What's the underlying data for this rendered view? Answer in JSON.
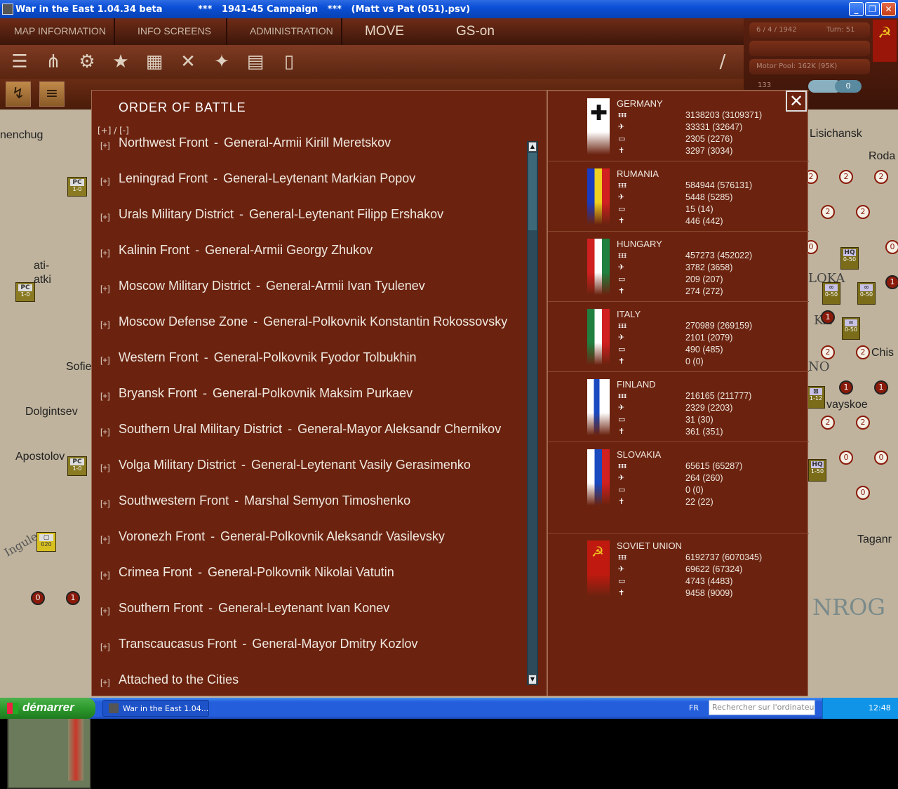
{
  "window": {
    "app_name": "War in the East 1.04.34 beta",
    "title": "***   1941-45 Campaign   ***   (Matt vs Pat (051).psv)",
    "min": "_",
    "max": "❐",
    "close": "✕"
  },
  "menu": {
    "map_information": "MAP INFORMATION",
    "info_screens": "INFO SCREENS",
    "administration": "ADMINISTRATION",
    "move": "MOVE",
    "gs": "GS-on"
  },
  "info": {
    "date": "6 / 4 / 1942",
    "turn": "Turn: 51",
    "motor_pool": "Motor Pool:  162K (95K)",
    "count": "133",
    "value": "0"
  },
  "map_labels": [
    "nenchug",
    "ati-",
    "atki",
    "Sofie",
    "Dolgintsev",
    "Apostolov",
    "Ingule",
    "Lisichansk",
    "Roda",
    "LOKA",
    "KA",
    "NO",
    "Chis",
    "vayskoe",
    "Taganr",
    "NROG"
  ],
  "units": {
    "pc": "PC",
    "pc_str": "1-0",
    "hq": "HQ",
    "hq1": "0-50",
    "hq2": "1-50",
    "u12": "1-12",
    "c020": "020"
  },
  "oob": {
    "title": "ORDER OF BATTLE",
    "expand_all": "[+] / [-]",
    "fronts": [
      {
        "name": "Northwest Front",
        "commander": "General-Armii Kirill Meretskov"
      },
      {
        "name": "Leningrad Front",
        "commander": "General-Leytenant Markian Popov"
      },
      {
        "name": "Urals Military District",
        "commander": "General-Leytenant Filipp Ershakov"
      },
      {
        "name": "Kalinin Front",
        "commander": "General-Armii Georgy Zhukov"
      },
      {
        "name": "Moscow Military District",
        "commander": "General-Armii Ivan Tyulenev"
      },
      {
        "name": "Moscow Defense Zone",
        "commander": "General-Polkovnik Konstantin Rokossovsky"
      },
      {
        "name": "Western Front",
        "commander": "General-Polkovnik Fyodor Tolbukhin"
      },
      {
        "name": "Bryansk Front",
        "commander": "General-Polkovnik Maksim Purkaev"
      },
      {
        "name": "Southern Ural Military District",
        "commander": "General-Mayor Aleksandr Chernikov"
      },
      {
        "name": "Volga Military District",
        "commander": "General-Leytenant Vasily Gerasimenko"
      },
      {
        "name": "Southwestern Front",
        "commander": "Marshal Semyon Timoshenko"
      },
      {
        "name": "Voronezh Front",
        "commander": "General-Polkovnik Aleksandr Vasilevsky"
      },
      {
        "name": "Crimea Front",
        "commander": "General-Polkovnik Nikolai Vatutin"
      },
      {
        "name": "Southern Front",
        "commander": "General-Leytenant Ivan Konev"
      },
      {
        "name": "Transcaucasus Front",
        "commander": "General-Mayor Dmitry Kozlov"
      },
      {
        "name": "Attached to the Cities",
        "commander": ""
      }
    ],
    "plus": "[+]",
    "dash": "-"
  },
  "countries": [
    {
      "name": "GERMANY",
      "men": "3138203 (3109371)",
      "guns": "33331 (32647)",
      "afv": "2305 (2276)",
      "air": "3297 (3034)",
      "flag": "germany"
    },
    {
      "name": "RUMANIA",
      "men": "584944 (576131)",
      "guns": "5448 (5285)",
      "afv": "15 (14)",
      "air": "446 (442)",
      "flag": "rumania"
    },
    {
      "name": "HUNGARY",
      "men": "457273 (452022)",
      "guns": "3782 (3658)",
      "afv": "209 (207)",
      "air": "274 (272)",
      "flag": "hungary"
    },
    {
      "name": "ITALY",
      "men": "270989 (269159)",
      "guns": "2101 (2079)",
      "afv": "490 (485)",
      "air": "0 (0)",
      "flag": "italy"
    },
    {
      "name": "FINLAND",
      "men": "216165 (211777)",
      "guns": "2329 (2203)",
      "afv": "31 (30)",
      "air": "361 (351)",
      "flag": "finland"
    },
    {
      "name": "SLOVAKIA",
      "men": "65615 (65287)",
      "guns": "264 (260)",
      "afv": "0 (0)",
      "air": "22 (22)",
      "flag": "slovakia"
    },
    {
      "name": "SOVIET UNION",
      "men": "6192737 (6070345)",
      "guns": "69622 (67324)",
      "afv": "4743 (4483)",
      "air": "9458 (9009)",
      "flag": "soviet"
    }
  ],
  "taskbar": {
    "start": "démarrer",
    "app": "War in the East 1.04....",
    "lang": "FR",
    "search_placeholder": "Rechercher sur l'ordinateur",
    "clock": "12:48"
  },
  "colors": {
    "panel": "#6b2310",
    "title_blue": "#0a4fd6"
  }
}
